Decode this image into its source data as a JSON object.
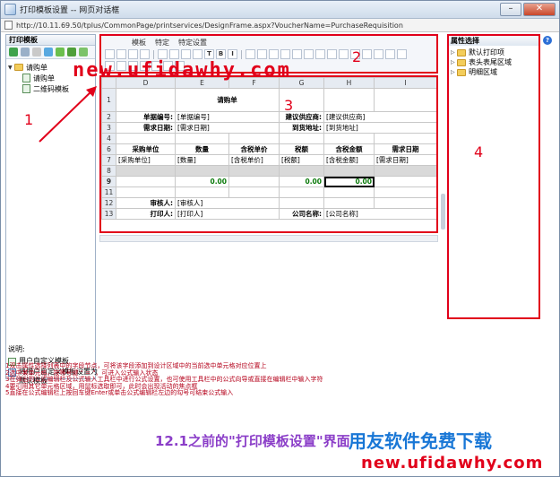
{
  "window": {
    "title": "打印模板设置 -- 网页对话框",
    "url": "http://10.11.69.50/tplus/CommonPage/printservices/DesignFrame.aspx?VoucherName=PurchaseRequisition"
  },
  "watermark": "new.ufidawhy.com",
  "left_panel": {
    "title": "打印模板",
    "tree": [
      {
        "label": "请购单",
        "level": 0
      },
      {
        "label": "请购单",
        "level": 1
      },
      {
        "label": "二维码模板",
        "level": 1
      }
    ]
  },
  "legend": {
    "title": "说明:",
    "items": [
      {
        "label": "用户自定义模板"
      },
      {
        "label": "将用户自定义模板设置为默认模板"
      }
    ]
  },
  "toolbar": {
    "tabs": [
      "模板",
      "特定",
      "特定设置"
    ],
    "bold_label": "T",
    "italic_label": "B",
    "underline_label": "I"
  },
  "sheet": {
    "columns": [
      "",
      "D",
      "E",
      "F",
      "G",
      "H",
      "I"
    ],
    "rows": [
      {
        "num": "1",
        "cells": [
          "",
          "请购单",
          "",
          "",
          "",
          ""
        ]
      },
      {
        "num": "2",
        "cells": [
          "单据编号:",
          "[单据编号]",
          "",
          "建议供应商:",
          "[建议供应商]",
          ""
        ]
      },
      {
        "num": "3",
        "cells": [
          "需求日期:",
          "[需求日期]",
          "",
          "到货地址:",
          "[到货地址]",
          ""
        ]
      },
      {
        "num": "4",
        "cells": [
          "",
          "",
          "",
          "",
          "",
          ""
        ]
      },
      {
        "num": "6",
        "cells": [
          "采购单位",
          "数量",
          "含税单价",
          "税额",
          "含税金额",
          "需求日期"
        ]
      },
      {
        "num": "7",
        "cells": [
          "[采购单位]",
          "[数量]",
          "[含税单价]",
          "[税额]",
          "[含税金额]",
          "[需求日期]"
        ]
      },
      {
        "num": "8",
        "cells": [
          "",
          "",
          "",
          "",
          "",
          ""
        ]
      },
      {
        "num": "9",
        "cells": [
          "",
          "0.00",
          "",
          "0.00",
          "0.00",
          ""
        ]
      },
      {
        "num": "11",
        "cells": [
          "",
          "",
          "",
          "",
          "",
          ""
        ]
      },
      {
        "num": "12",
        "cells": [
          "审核人:",
          "[审核人]",
          "",
          "",
          "",
          ""
        ]
      },
      {
        "num": "13",
        "cells": [
          "打印人:",
          "[打印人]",
          "",
          "公司名称:",
          "[公司名称]",
          ""
        ]
      }
    ]
  },
  "right_panel": {
    "title": "属性选择",
    "tree": [
      {
        "label": "默认打印项"
      },
      {
        "label": "表头表尾区域"
      },
      {
        "label": "明细区域"
      }
    ]
  },
  "annotations": {
    "n1": "1",
    "n2": "2",
    "n3": "3",
    "n4": "4"
  },
  "instructions": [
    "1双击属性选择列表中的字段节点，可将该字段添加到设计区域中的当前选中单元格对应位置上",
    "2选中某单元格，按等号键 \" = \"，可进入公式输入状态",
    "3在弹出的公式编辑栏及公式输入工具栏中进行公式设置，也可使用工具栏中的公式向导或直接在编辑栏中输入字符",
    "4要引用其它单元格区域，用鼠标选取即可，此时会出现活动的焦点框",
    "5直接在公式编辑栏上按回车键Enter或单击公式编辑栏左边的勾号可结束公式输入"
  ],
  "caption": "12.1之前的\"打印模板设置\"界面",
  "brand": {
    "name": "用友软件免费下载",
    "url": "new.ufidawhy.com"
  },
  "colors": {
    "annotation_red": "#e1001a",
    "caption_purple": "#8b3ec8",
    "brand_blue": "#1977d6",
    "value_green": "#0a7a0a"
  }
}
